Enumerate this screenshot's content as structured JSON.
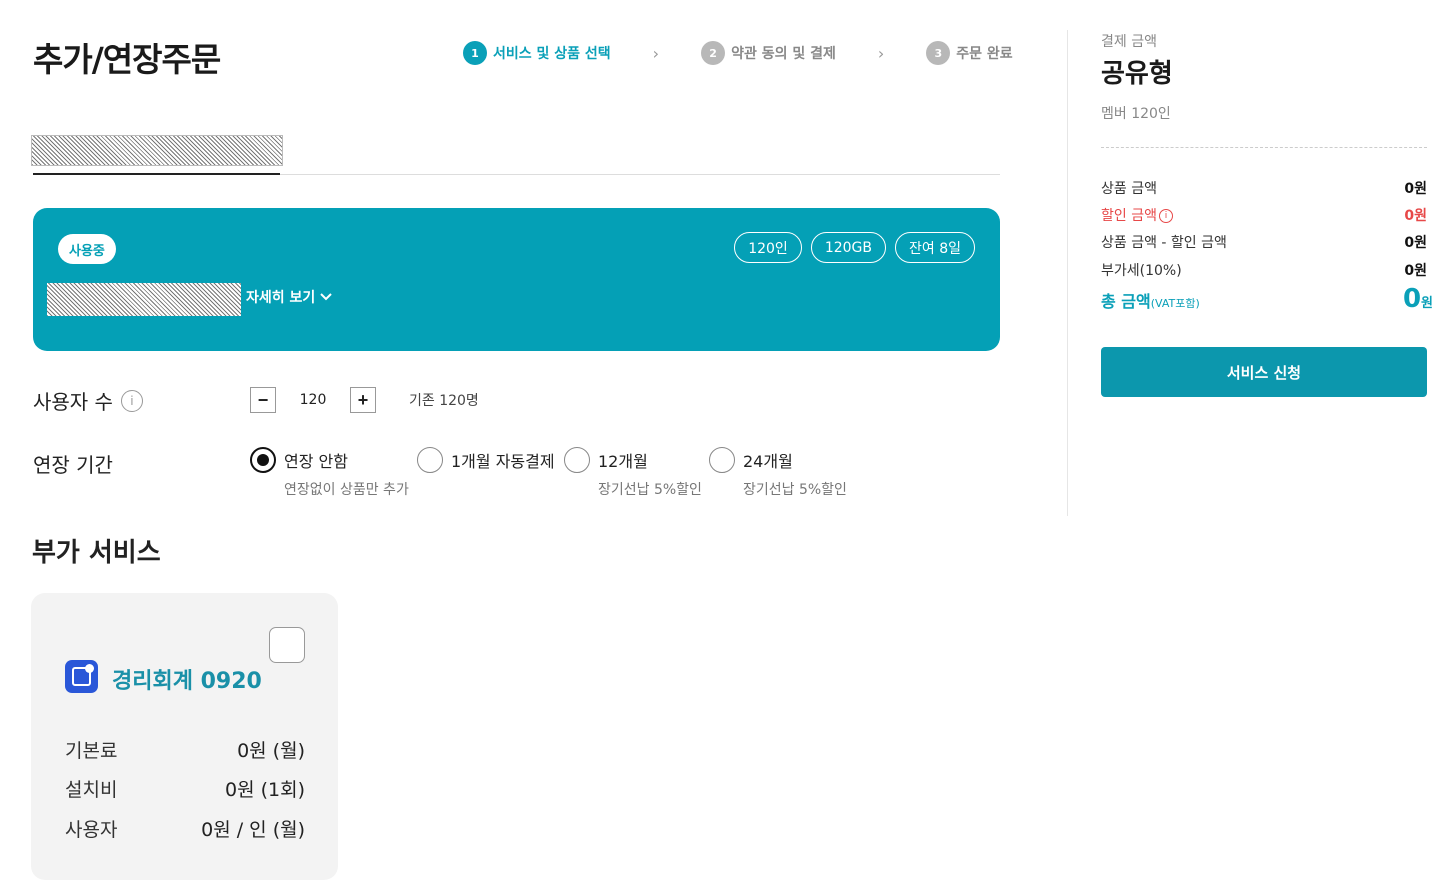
{
  "page_title": "추가/연장주문",
  "steps": [
    {
      "num": "1",
      "label": "서비스 및 상품 선택"
    },
    {
      "num": "2",
      "label": "약관 동의 및 결제"
    },
    {
      "num": "3",
      "label": "주문 완료"
    }
  ],
  "step_separator": "›",
  "card": {
    "status": "사용중",
    "pills": [
      "120인",
      "120GB",
      "잔여 8일"
    ],
    "detail_link": "자세히 보기"
  },
  "users": {
    "label": "사용자 수",
    "minus": "−",
    "value": "120",
    "plus": "+",
    "base": "기존 120명"
  },
  "period": {
    "label": "연장 기간",
    "options": [
      {
        "label": "연장 안함",
        "sub": "연장없이 상품만 추가"
      },
      {
        "label": "1개월 자동결제",
        "sub": ""
      },
      {
        "label": "12개월",
        "sub": "장기선납 5%할인"
      },
      {
        "label": "24개월",
        "sub": "장기선납 5%할인"
      }
    ],
    "selected": 0
  },
  "addons": {
    "title": "부가 서비스",
    "items": [
      {
        "name": "경리회계 0920",
        "rows": [
          {
            "k": "기본료",
            "v": "0원 (월)"
          },
          {
            "k": "설치비",
            "v": "0원 (1회)"
          },
          {
            "k": "사용자",
            "v": "0원 / 인 (월)"
          }
        ]
      }
    ]
  },
  "summary": {
    "caption": "결제 금액",
    "type": "공유형",
    "member": "멤버 120인",
    "rows": [
      {
        "k": "상품 금액",
        "v": "0원"
      },
      {
        "k": "할인 금액",
        "v": "0원"
      },
      {
        "k": "상품 금액 - 할인 금액",
        "v": "0원"
      },
      {
        "k": "부가세(10%)",
        "v": "0원"
      }
    ],
    "total_label": "총 금액",
    "total_note": "(VAT포함)",
    "total_value": "0",
    "total_unit": "원",
    "button": "서비스 신청"
  },
  "colors": {
    "accent": "#0aa0b8",
    "card": "#04a0b6",
    "discount": "#e74848",
    "addon_icon": "#2a57d8"
  }
}
